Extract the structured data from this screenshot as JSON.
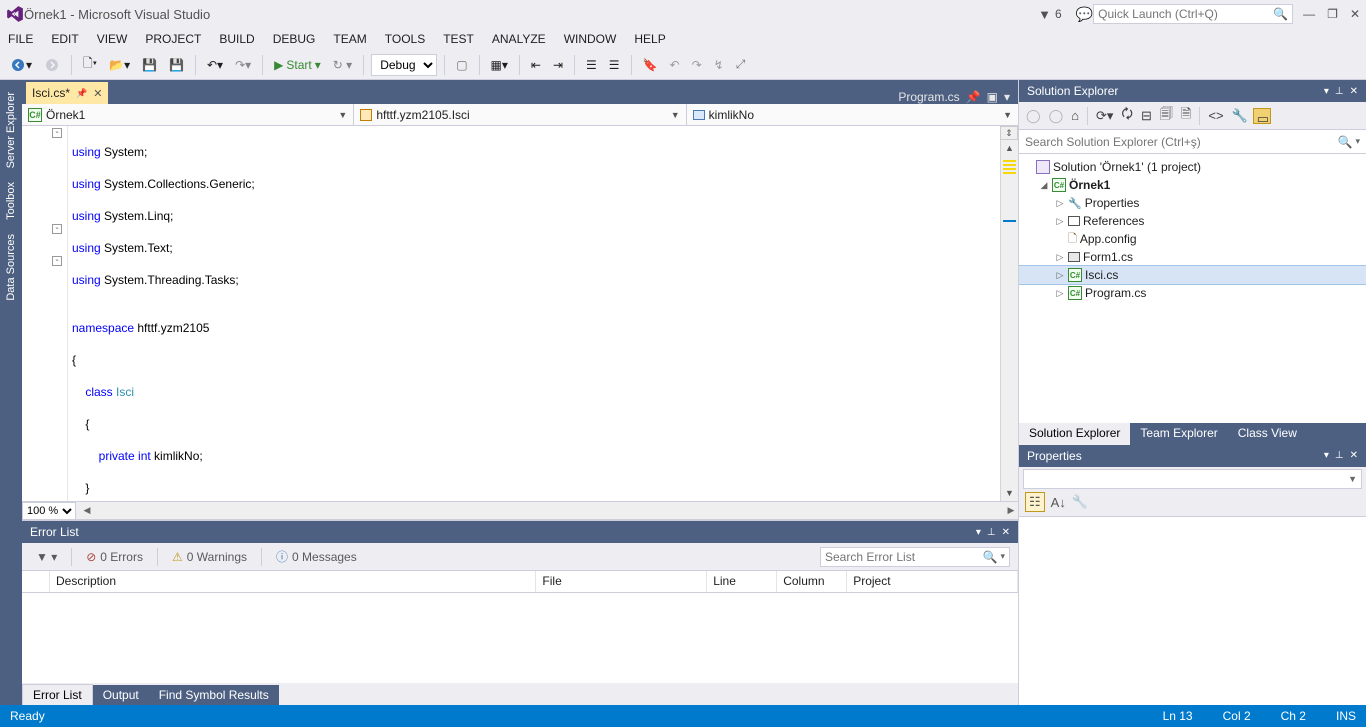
{
  "title": "Örnek1 - Microsoft Visual Studio",
  "notif_count": "6",
  "quicklaunch_placeholder": "Quick Launch (Ctrl+Q)",
  "menu": {
    "file": "FILE",
    "edit": "EDIT",
    "view": "VIEW",
    "project": "PROJECT",
    "build": "BUILD",
    "debug": "DEBUG",
    "team": "TEAM",
    "tools": "TOOLS",
    "test": "TEST",
    "analyze": "ANALYZE",
    "window": "WINDOW",
    "help": "HELP"
  },
  "toolbar": {
    "start": "Start",
    "config": "Debug"
  },
  "sidetabs": {
    "server": "Server Explorer",
    "toolbox": "Toolbox",
    "datasrc": "Data Sources"
  },
  "tabs": {
    "active": "Isci.cs*",
    "right": "Program.cs"
  },
  "nav": {
    "scope": "Örnek1",
    "type": "hfttf.yzm2105.Isci",
    "member": "kimlikNo"
  },
  "code": {
    "l1a": "using",
    "l1b": " System;",
    "l2a": "using",
    "l2b": " System.Collections.Generic;",
    "l3a": "using",
    "l3b": " System.Linq;",
    "l4a": "using",
    "l4b": " System.Text;",
    "l5a": "using",
    "l5b": " System.Threading.Tasks;",
    "l6": "",
    "l7a": "namespace",
    "l7b": " hfttf.yzm2105",
    "l8": "{",
    "l9a": "    class ",
    "l9b": "Isci",
    "l10": "    {",
    "l11a": "        private ",
    "l11b": "int",
    "l11c": " kimlikNo;",
    "l12": "    }",
    "l13": "}"
  },
  "zoom": "100 %",
  "errorlist": {
    "title": "Error List",
    "filter_errors": "0 Errors",
    "filter_warnings": "0 Warnings",
    "filter_messages": "0 Messages",
    "search_placeholder": "Search Error List",
    "cols": {
      "desc": "Description",
      "file": "File",
      "line": "Line",
      "col": "Column",
      "project": "Project"
    }
  },
  "bottom_tabs": {
    "errlist": "Error List",
    "output": "Output",
    "findsym": "Find Symbol Results"
  },
  "solution": {
    "title": "Solution Explorer",
    "search_placeholder": "Search Solution Explorer (Ctrl+ş)",
    "root": "Solution 'Örnek1' (1 project)",
    "proj": "Örnek1",
    "props": "Properties",
    "refs": "References",
    "appcfg": "App.config",
    "form1": "Form1.cs",
    "isci": "Isci.cs",
    "program": "Program.cs"
  },
  "right_tabs": {
    "sol": "Solution Explorer",
    "team": "Team Explorer",
    "classv": "Class View"
  },
  "properties": {
    "title": "Properties"
  },
  "status": {
    "ready": "Ready",
    "ln": "Ln 13",
    "col": "Col 2",
    "ch": "Ch 2",
    "ins": "INS"
  }
}
